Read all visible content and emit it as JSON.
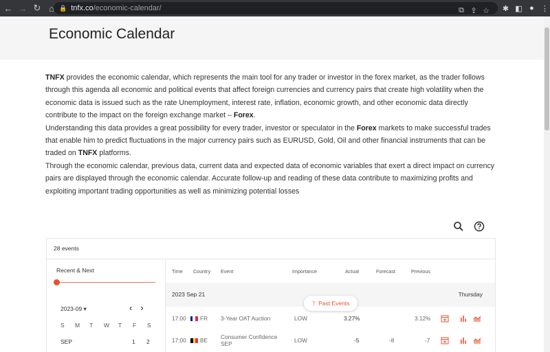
{
  "browser": {
    "url_host": "tnfx.co",
    "url_path": "/economic-calendar/"
  },
  "page": {
    "title": "Economic Calendar"
  },
  "intro": {
    "p1_brand": "TNFX",
    "p1_text": " provides the economic calendar, which represents the main tool for any trader or investor in the forex market, as the trader follows through this agenda all economic and political events that affect foreign currencies and currency pairs that create high volatility when the economic data is issued such as the rate Unemployment, interest rate, inflation, economic growth, and other economic data directly contribute to the impact on the foreign exchange market – ",
    "p1_forex": "Forex",
    "p1_end": ".",
    "p2_text": "Understanding this data provides a great possibility for every trader, investor or speculator in the ",
    "p2_forex": "Forex",
    "p2_mid": " markets to make successful trades that enable him to predict fluctuations in the major currency pairs such as EURUSD, Gold, Oil and other financial instruments that can be traded on ",
    "p2_brand": "TNFX",
    "p2_end": " platforms.",
    "p3_text": "Through the economic calendar, previous data, current data and expected data of economic variables that exert a direct impact on currency pairs are displayed through the economic calendar. Accurate follow-up and reading of these data contribute to maximizing profits and exploiting important trading opportunities as well as minimizing potential losses"
  },
  "calendar": {
    "events_count": "28 events",
    "range_label": "Recent & Next",
    "month_select": "2023-09 ▾",
    "weekdays": [
      "S",
      "M",
      "T",
      "W",
      "T",
      "F",
      "S"
    ],
    "month_abbr": "SEP",
    "days": [
      "1",
      "2"
    ],
    "columns": {
      "time": "Time",
      "country": "Country",
      "event": "Event",
      "importance": "Importance",
      "actual": "Actual",
      "forecast": "Forecast",
      "previous": "Previous"
    },
    "date_header": "2023 Sep 21",
    "weekday_header": "Thursday",
    "past_events_label": "Past Events",
    "rows": [
      {
        "time": "17:00",
        "country": "FR",
        "event": "3-Year OAT Auction",
        "importance": "LOW",
        "actual": "3.27%",
        "forecast": "",
        "previous": "3.12%",
        "flag": [
          "#002395",
          "#ffffff",
          "#ed2939"
        ]
      },
      {
        "time": "17:00",
        "country": "BE",
        "event": "Consumer Confidence SEP",
        "importance": "LOW",
        "actual": "-5",
        "forecast": "-8",
        "previous": "-7",
        "flag": [
          "#000000",
          "#fdda24",
          "#ef3340"
        ]
      }
    ]
  },
  "colors": {
    "accent": "#e8512f"
  }
}
